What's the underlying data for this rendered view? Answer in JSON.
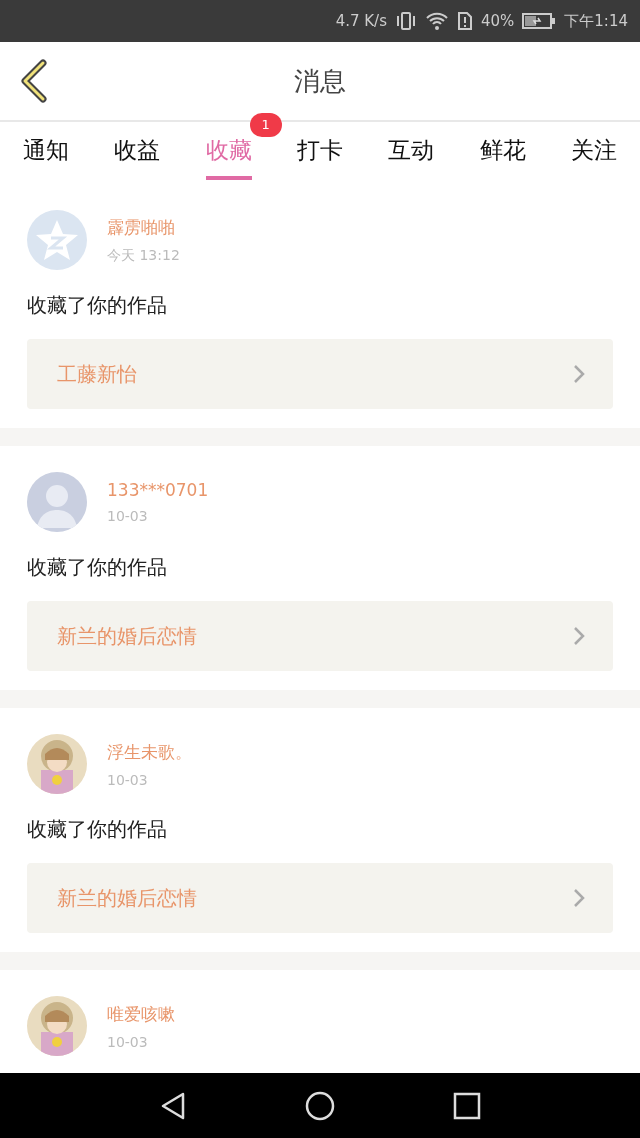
{
  "status_bar": {
    "speed": "4.7 K/s",
    "battery": "40%",
    "time": "下午1:14"
  },
  "header": {
    "title": "消息"
  },
  "tabs": [
    {
      "label": "通知",
      "selected": false
    },
    {
      "label": "收益",
      "selected": false
    },
    {
      "label": "收藏",
      "selected": true,
      "badge": "1"
    },
    {
      "label": "打卡",
      "selected": false
    },
    {
      "label": "互动",
      "selected": false
    },
    {
      "label": "鲜花",
      "selected": false
    },
    {
      "label": "关注",
      "selected": false
    }
  ],
  "messages": [
    {
      "avatar": {
        "kind": "logo"
      },
      "name": "霹雳啪啪",
      "time": "今天 13:12",
      "action": "收藏了你的作品",
      "work": "工藤新怡"
    },
    {
      "avatar": {
        "kind": "silhouette"
      },
      "name": "133***0701",
      "time": "10-03",
      "action": "收藏了你的作品",
      "work": "新兰的婚后恋情"
    },
    {
      "name": "浮生未歌。",
      "time": "10-03",
      "action": "收藏了你的作品",
      "work": "新兰的婚后恋情"
    },
    {
      "name": "唯爱咳嗽",
      "time": "10-03"
    }
  ]
}
